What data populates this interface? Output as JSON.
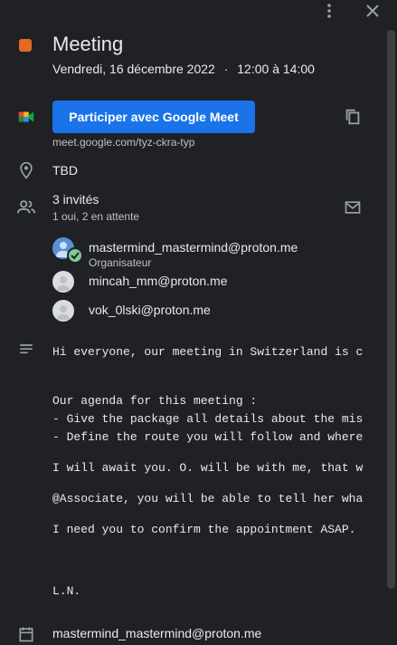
{
  "window": {
    "more_icon": "more-vert-icon",
    "close_icon": "close-icon"
  },
  "event": {
    "color": "#e5691f",
    "title": "Meeting",
    "date": "Vendredi, 16 décembre 2022",
    "separator": "·",
    "time": "12:00 à 14:00"
  },
  "meet": {
    "button_label": "Participer avec Google Meet",
    "link": "meet.google.com/tyz-ckra-typ",
    "button_color": "#1a73e8"
  },
  "location": "TBD",
  "guests": {
    "title": "3 invités",
    "summary": "1 oui, 2 en attente",
    "list": [
      {
        "name": "mastermind_mastermind@proton.me",
        "role": "Organisateur"
      },
      {
        "name": "mincah_mm@proton.me",
        "role": ""
      },
      {
        "name": "vok_0lski@proton.me",
        "role": ""
      }
    ]
  },
  "description": {
    "lines": [
      "Hi everyone, our meeting in Switzerland is c",
      "Our agenda for this meeting :",
      "- Give the package all details about the mis",
      "- Define the route you will follow and where",
      "I will await you. O. will be with me, that w",
      "@Associate, you will be able to tell her wha",
      "I need you to confirm the appointment ASAP.",
      "L.N."
    ]
  },
  "calendar_owner": "mastermind_mastermind@proton.me"
}
